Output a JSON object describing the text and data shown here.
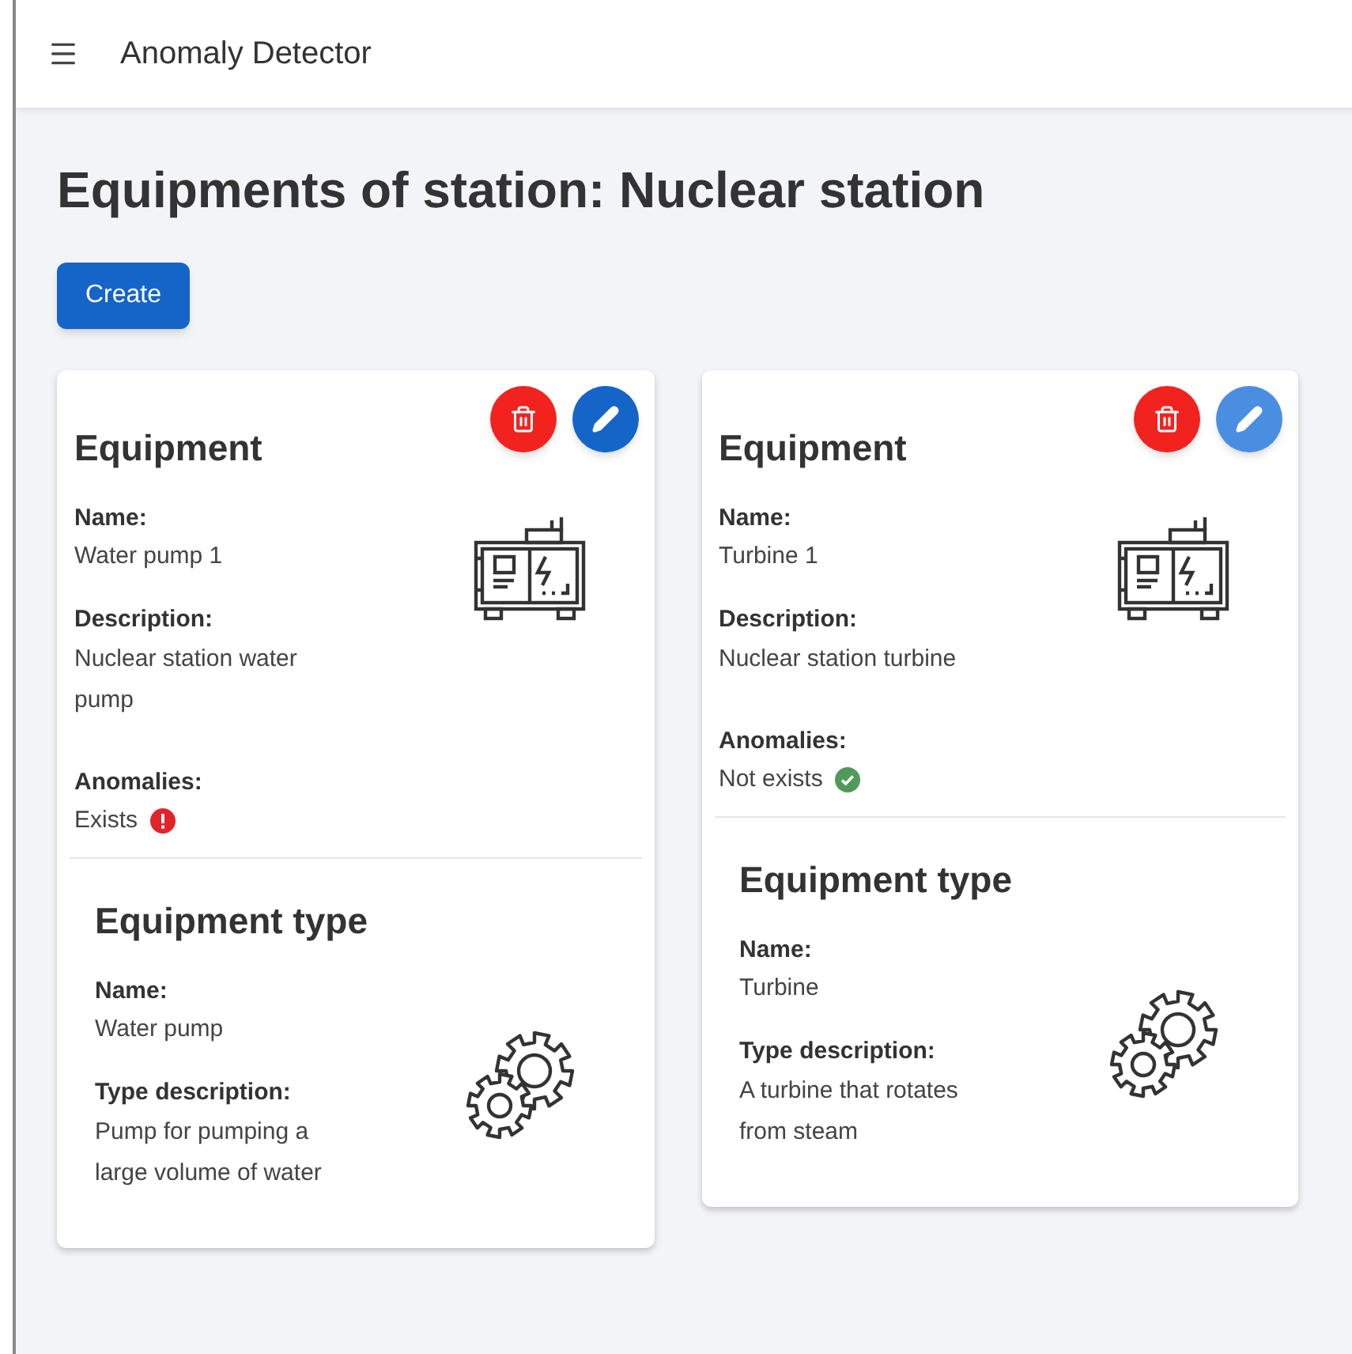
{
  "app_bar": {
    "title": "Anomaly Detector"
  },
  "page_title": "Equipments of station: Nuclear station",
  "create_button": "Create",
  "cards": [
    {
      "heading": "Equipment",
      "edit_hovered": false,
      "fields": [
        {
          "label": "Name:",
          "value": "Water pump 1"
        },
        {
          "label": "Description:",
          "value": "Nuclear station water pump"
        }
      ],
      "anomalies": {
        "label": "Anomalies:",
        "value": "Exists",
        "kind": "exists"
      },
      "type": {
        "heading": "Equipment type",
        "fields": [
          {
            "label": "Name:",
            "value": "Water pump"
          },
          {
            "label": "Type description:",
            "value": "Pump for pumping a large volume of water"
          }
        ]
      }
    },
    {
      "heading": "Equipment",
      "edit_hovered": true,
      "fields": [
        {
          "label": "Name:",
          "value": "Turbine 1"
        },
        {
          "label": "Description:",
          "value": "Nuclear station turbine"
        }
      ],
      "anomalies": {
        "label": "Anomalies:",
        "value": "Not exists",
        "kind": "absent"
      },
      "type": {
        "heading": "Equipment type",
        "fields": [
          {
            "label": "Name:",
            "value": "Turbine"
          },
          {
            "label": "Type description:",
            "value": "A turbine that rotates from steam"
          }
        ]
      }
    }
  ]
}
